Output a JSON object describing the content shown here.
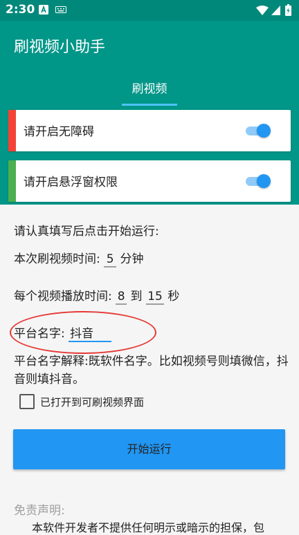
{
  "status_bar": {
    "time": "2:30"
  },
  "app": {
    "title": "刷视频小助手"
  },
  "tabs": [
    {
      "label": "刷视频"
    }
  ],
  "cards": [
    {
      "label": "请开启无障碍",
      "stripe_color": "#f44336",
      "switch_on": true
    },
    {
      "label": "请开启悬浮窗权限",
      "stripe_color": "#4caf50",
      "switch_on": true
    }
  ],
  "form": {
    "intro": "请认真填写后点击开始运行:",
    "duration_label": "本次刷视频时间:",
    "duration_value": "5",
    "duration_unit": "分钟",
    "per_video_label": "每个视频播放时间:",
    "per_video_min": "8",
    "per_video_to": "到",
    "per_video_max": "15",
    "per_video_unit": "秒",
    "platform_label": "平台名字:",
    "platform_value": "抖音",
    "platform_explain": "平台名字解释:既软件名字。比如视频号则填微信，抖音则填抖音。",
    "checkbox_label": "已打开到可刷视频界面",
    "checkbox_checked": false,
    "start_button": "开始运行"
  },
  "disclaimer": {
    "title": "免责声明:",
    "text": "本软件开发者不提供任何明示或暗示的担保，包"
  },
  "colors": {
    "appbar": "#009688",
    "statusbar": "#00897b",
    "accent": "#2196f3",
    "annotation": "#e53935"
  }
}
